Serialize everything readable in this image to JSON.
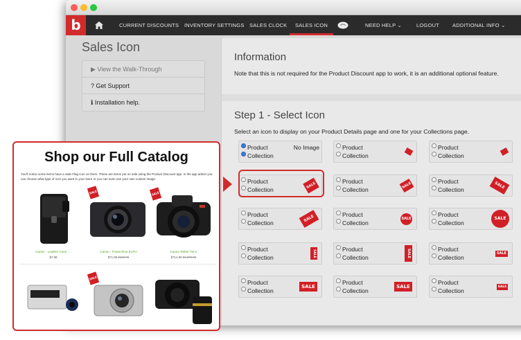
{
  "nav": {
    "logo": "b",
    "home_icon": "home-icon",
    "items": [
      "CURRENT DISCOUNTS",
      "INVENTORY SETTINGS",
      "SALES CLOCK",
      "SALES ICON",
      "NEED HELP",
      "LOGOUT",
      "ADDITIONAL INFO"
    ],
    "active": "SALES ICON"
  },
  "page": {
    "title": "Sales Icon",
    "menu": [
      "▶ View the Walk-Through",
      "? Get Support",
      "ℹ Installation help."
    ]
  },
  "info": {
    "heading": "Information",
    "text": "Note that this is not required for the Product Discount app to work, it is an additional optional feature."
  },
  "step": {
    "heading": "Step 1 - Select Icon",
    "description": "Select an icon to display on your Product Details page and one for your Collections page."
  },
  "option_labels": {
    "product": "Product",
    "collection": "Collection",
    "no_image": "No Image"
  },
  "tag_text": "SALE",
  "catalog": {
    "title": "Shop our Full Catalog",
    "description": "You'll notice some items have a Sale Flag Icon on them. These are items put on sale using the Product Discount app. In the app admin you can choose what type of icon you want in your store or you can even use your own custom image.",
    "products": [
      {
        "name": "Canon - Leather Case -...",
        "price": "$7.99",
        "old_price": ""
      },
      {
        "name": "Canon - PowerShot ELPH",
        "price": "$71.99",
        "old_price": "$129.99"
      },
      {
        "name": "Canon Rebel T5I K",
        "price": "$714.99",
        "old_price": "$1,099.99"
      }
    ]
  },
  "colors": {
    "accent": "#d22b2b",
    "nav_bg": "#2b2b2b",
    "tag": "#d11f26"
  }
}
